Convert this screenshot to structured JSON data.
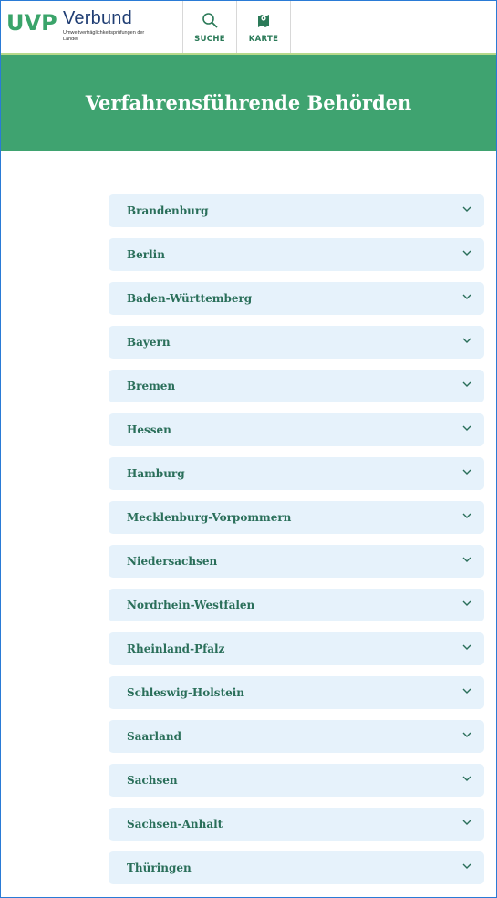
{
  "brand": {
    "mark": "UVP",
    "title": "Verbund",
    "subtitle": "Umweltverträglichkeitsprüfungen der Länder",
    "colors": {
      "green": "#3aa46a",
      "navy": "#1f3d73"
    }
  },
  "nav": {
    "search": {
      "label": "SUCHE",
      "icon": "search-icon"
    },
    "map": {
      "label": "KARTE",
      "icon": "map-icon"
    }
  },
  "banner": {
    "title": "Verfahrensführende Behörden",
    "color": "#3fa370"
  },
  "states": [
    {
      "label": "Brandenburg"
    },
    {
      "label": "Berlin"
    },
    {
      "label": "Baden-Württemberg"
    },
    {
      "label": "Bayern"
    },
    {
      "label": "Bremen"
    },
    {
      "label": "Hessen"
    },
    {
      "label": "Hamburg"
    },
    {
      "label": "Mecklenburg-Vorpommern"
    },
    {
      "label": "Niedersachsen"
    },
    {
      "label": "Nordrhein-Westfalen"
    },
    {
      "label": "Rheinland-Pfalz"
    },
    {
      "label": "Schleswig-Holstein"
    },
    {
      "label": "Saarland"
    },
    {
      "label": "Sachsen"
    },
    {
      "label": "Sachsen-Anhalt"
    },
    {
      "label": "Thüringen"
    }
  ]
}
